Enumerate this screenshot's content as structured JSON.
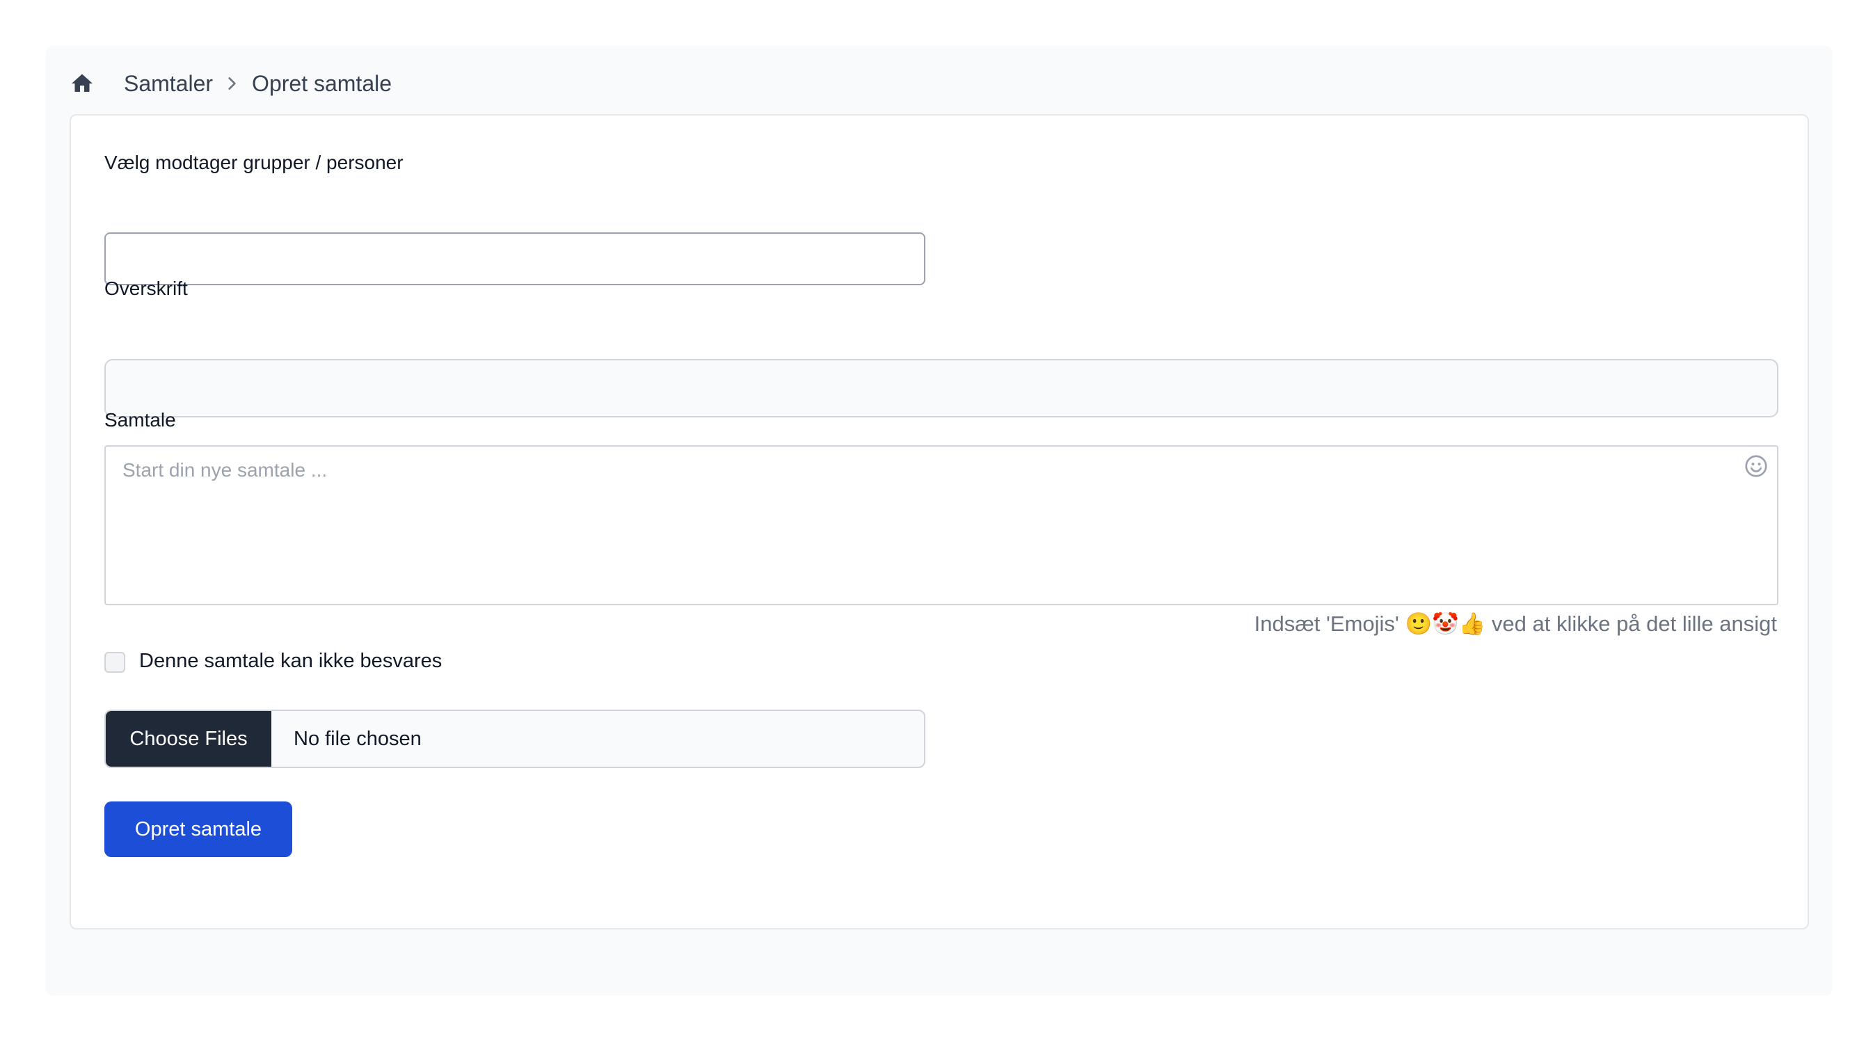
{
  "breadcrumb": {
    "home_icon": "home-icon",
    "items": [
      "Samtaler",
      "Opret samtale"
    ]
  },
  "form": {
    "recipients_label": "Vælg modtager grupper / personer",
    "recipients_value": "",
    "title_label": "Overskrift",
    "title_value": "",
    "message_label": "Samtale",
    "message_placeholder": "Start din nye samtale ...",
    "emoji_icon": "smiley-icon",
    "emoji_hint_before": "Indsæt 'Emojis' ",
    "emoji_hint_emojis": "🙂🤡👍",
    "emoji_hint_after": " ved at klikke på det lille ansigt",
    "no_reply_label": "Denne samtale kan ikke besvares",
    "no_reply_checked": false,
    "file_button": "Choose Files",
    "file_status": "No file chosen",
    "submit_label": "Opret samtale"
  },
  "colors": {
    "primary": "#1d4ed8",
    "file_button_bg": "#1f2937",
    "panel_bg": "#f9fafb"
  }
}
